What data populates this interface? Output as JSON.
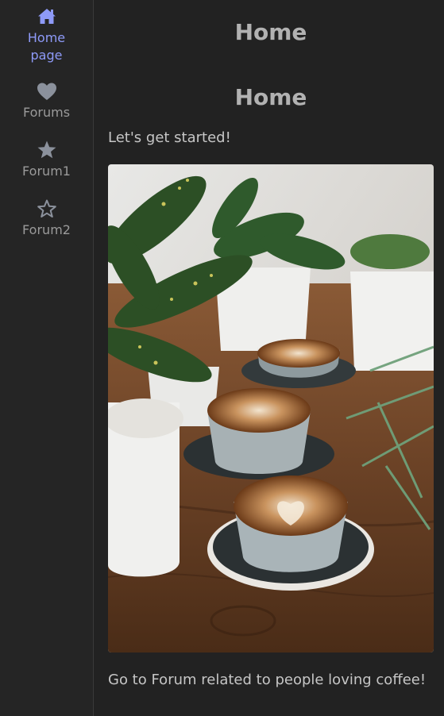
{
  "sidebar": {
    "items": [
      {
        "label_line1": "Home",
        "label_line2": "page",
        "icon": "home-icon",
        "active": true
      },
      {
        "label": "Forums",
        "icon": "heart-icon"
      },
      {
        "label": "Forum1",
        "icon": "star-filled-icon"
      },
      {
        "label": "Forum2",
        "icon": "star-outline-icon"
      }
    ]
  },
  "main": {
    "page_title": "Home",
    "section_title": "Home",
    "intro_text": "Let's get started!",
    "image": {
      "subject": "latte-art-coffee-cups-with-plants"
    },
    "link_text": "Go to Forum related to people loving coffee!"
  },
  "colors": {
    "background": "#222222",
    "sidebar_background": "#252525",
    "active_accent": "#8e9af8",
    "icon_color": "#8b919c",
    "text": "#c6c6c6",
    "title": "#b2b2b2"
  }
}
